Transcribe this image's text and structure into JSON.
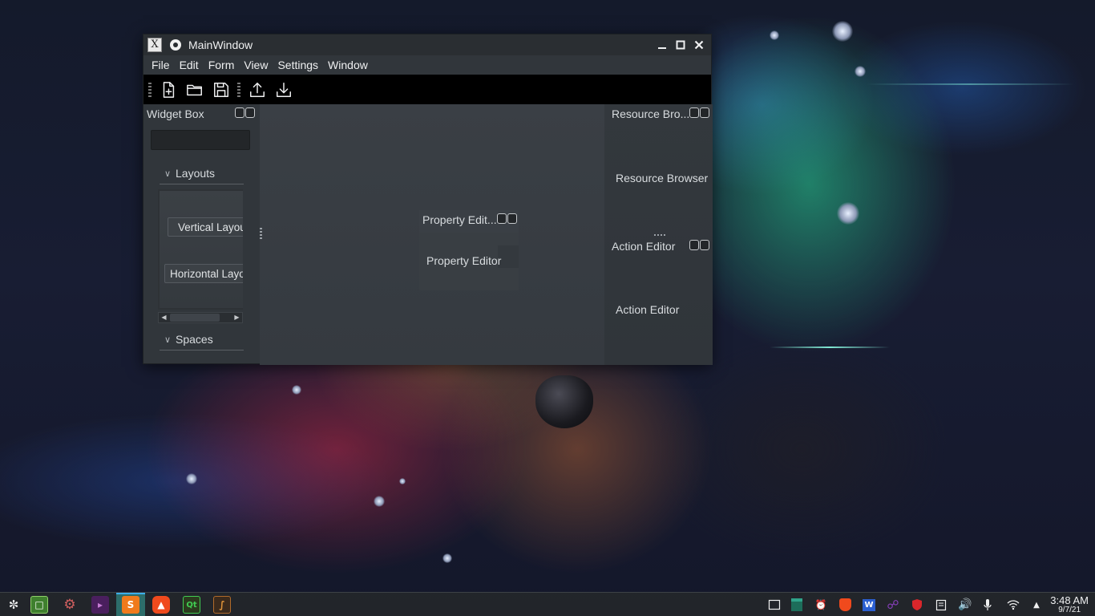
{
  "window": {
    "title": "MainWindow",
    "app_icon_glyph": "X"
  },
  "menu": [
    "File",
    "Edit",
    "Form",
    "View",
    "Settings",
    "Window"
  ],
  "toolbar": {
    "icons": [
      "new-file-icon",
      "open-folder-icon",
      "save-icon",
      "upload-icon",
      "download-icon"
    ]
  },
  "widget_box": {
    "title": "Widget Box",
    "search_value": "",
    "categories": [
      "Layouts",
      "Spaces"
    ],
    "items": [
      "Vertical Layout",
      "Horizontal Layout"
    ]
  },
  "property_editor": {
    "title": "Property Edit...",
    "content": "Property Editor"
  },
  "resource_browser": {
    "title": "Resource Bro...",
    "content": "Resource Browser"
  },
  "action_editor": {
    "title": "Action Editor",
    "content": "Action Editor"
  },
  "taskbar": {
    "apps": [
      "application-launcher-icon",
      "file-manager-icon",
      "settings-icon",
      "terminal-icon",
      "sublime-text-icon",
      "brave-browser-icon",
      "qt-creator-icon",
      "system-monitor-icon"
    ],
    "tray": [
      "show-desktop-icon",
      "clipboard-manager-icon",
      "alarm-icon",
      "brave-tray-icon",
      "office-icon",
      "vpn-icon",
      "security-shield-icon",
      "notes-icon",
      "volume-icon",
      "microphone-icon",
      "wifi-icon",
      "expand-tray-icon"
    ],
    "clock_time": "3:48 AM",
    "clock_date": "9/7/21"
  },
  "colors": {
    "window_bg": "#31363b",
    "toolbar_bg": "#000000",
    "accent": "#3daee9",
    "text": "#eff0f1",
    "taskbar_active": "#2d6d6a"
  }
}
